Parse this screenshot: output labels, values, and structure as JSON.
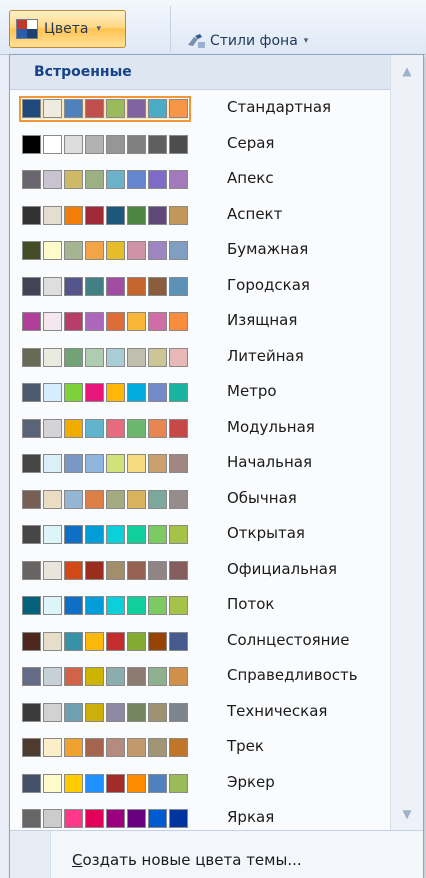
{
  "ribbon": {
    "colors_button": {
      "label": "Цвета",
      "icon": "theme-colors-icon",
      "caret": "▾"
    },
    "background_styles_button": {
      "label": "Стили фона",
      "icon": "background-brush-icon",
      "caret": "▾"
    }
  },
  "gallery": {
    "section_title": "Встроенные",
    "scroll_up": "▲",
    "scroll_down": "▼",
    "themes": [
      {
        "label": "Стандартная",
        "selected": true,
        "colors": [
          "#1f497d",
          "#eeece1",
          "#4f81bd",
          "#c0504d",
          "#9bbb59",
          "#8064a2",
          "#4bacc6",
          "#f79646"
        ]
      },
      {
        "label": "Серая",
        "colors": [
          "#000000",
          "#ffffff",
          "#dddddd",
          "#b2b2b2",
          "#969696",
          "#808080",
          "#5f5f5f",
          "#4d4d4d"
        ]
      },
      {
        "label": "Апекс",
        "colors": [
          "#69676d",
          "#c9c2d1",
          "#ceb966",
          "#9cb084",
          "#6bb1c9",
          "#6585cf",
          "#7e6bc9",
          "#a379bb"
        ]
      },
      {
        "label": "Аспект",
        "colors": [
          "#323232",
          "#e3ded1",
          "#f07f09",
          "#9f2936",
          "#1b587c",
          "#4e8542",
          "#604878",
          "#c19859"
        ]
      },
      {
        "label": "Бумажная",
        "colors": [
          "#444d26",
          "#fefac9",
          "#a5b592",
          "#f3a447",
          "#e7bc29",
          "#d092a7",
          "#9c85c0",
          "#809ec2"
        ]
      },
      {
        "label": "Городская",
        "colors": [
          "#424456",
          "#dedede",
          "#53548a",
          "#438086",
          "#a04da3",
          "#c4652d",
          "#8b5d3d",
          "#5c92b5"
        ]
      },
      {
        "label": "Изящная",
        "colors": [
          "#b13f9a",
          "#f4e7ed",
          "#b83d68",
          "#ac66bb",
          "#de6c36",
          "#f9b639",
          "#cf6da4",
          "#fa8d3d"
        ]
      },
      {
        "label": "Литейная",
        "colors": [
          "#676a55",
          "#eaebde",
          "#72a376",
          "#b0ccb0",
          "#a8cdd7",
          "#c0beaf",
          "#cec597",
          "#e8b7b7"
        ]
      },
      {
        "label": "Метро",
        "colors": [
          "#4e5b6f",
          "#d6ecff",
          "#7fd13b",
          "#ea157a",
          "#feb80a",
          "#00addc",
          "#738ac8",
          "#1ab39f"
        ]
      },
      {
        "label": "Модульная",
        "colors": [
          "#5a6378",
          "#d4d4d6",
          "#f0ad00",
          "#60b5cc",
          "#e66c7d",
          "#6bb76d",
          "#e88651",
          "#c64847"
        ]
      },
      {
        "label": "Начальная",
        "colors": [
          "#464646",
          "#dbeff9",
          "#7a98c5",
          "#8fb5dc",
          "#d1e27a",
          "#f6da80",
          "#caa070",
          "#a08781"
        ]
      },
      {
        "label": "Обычная",
        "colors": [
          "#775f55",
          "#ebddc3",
          "#94b6d2",
          "#dd8047",
          "#a5ab81",
          "#d8b25c",
          "#7ba79d",
          "#968c8c"
        ]
      },
      {
        "label": "Открытая",
        "colors": [
          "#464646",
          "#dbf5f9",
          "#0f6fc6",
          "#009dd9",
          "#0bd0d9",
          "#10cf9b",
          "#7cca62",
          "#a5c249"
        ]
      },
      {
        "label": "Официальная",
        "colors": [
          "#696464",
          "#e9e5dc",
          "#d34817",
          "#9b2d1f",
          "#a28e6a",
          "#956251",
          "#918485",
          "#855d5d"
        ]
      },
      {
        "label": "Поток",
        "colors": [
          "#04617b",
          "#dbf5f9",
          "#0f6fc6",
          "#009dd9",
          "#0bd0d9",
          "#10cf9b",
          "#7cca62",
          "#a5c249"
        ]
      },
      {
        "label": "Солнцестояние",
        "colors": [
          "#4f271c",
          "#e7dec9",
          "#3891a7",
          "#feb80a",
          "#c32d2e",
          "#84aa33",
          "#964305",
          "#475a8d"
        ]
      },
      {
        "label": "Справедливость",
        "colors": [
          "#646b86",
          "#c5d1d7",
          "#d16349",
          "#ccb400",
          "#8cadae",
          "#8c7b70",
          "#8fb08c",
          "#d19049"
        ]
      },
      {
        "label": "Техническая",
        "colors": [
          "#3b3b3b",
          "#d4d2d0",
          "#6ea0b0",
          "#ccaf0a",
          "#8d89a4",
          "#748560",
          "#9e9273",
          "#7e848d"
        ]
      },
      {
        "label": "Трек",
        "colors": [
          "#4e3b30",
          "#fbeec9",
          "#f0a22e",
          "#a5644e",
          "#b58b80",
          "#c3986d",
          "#a19574",
          "#c17529"
        ]
      },
      {
        "label": "Эркер",
        "colors": [
          "#435169",
          "#fefac9",
          "#ffcc00",
          "#1e90ff",
          "#a52a2a",
          "#ff8c00",
          "#4f81bd",
          "#9bbb59"
        ]
      },
      {
        "label": "Яркая",
        "colors": [
          "#666666",
          "#cccccc",
          "#ff388c",
          "#e40059",
          "#9c007f",
          "#68007f",
          "#005bd3",
          "#00349e"
        ]
      }
    ]
  },
  "footer": {
    "create_link_mnemonic": "С",
    "create_link_rest": "оздать новые цвета темы..."
  }
}
